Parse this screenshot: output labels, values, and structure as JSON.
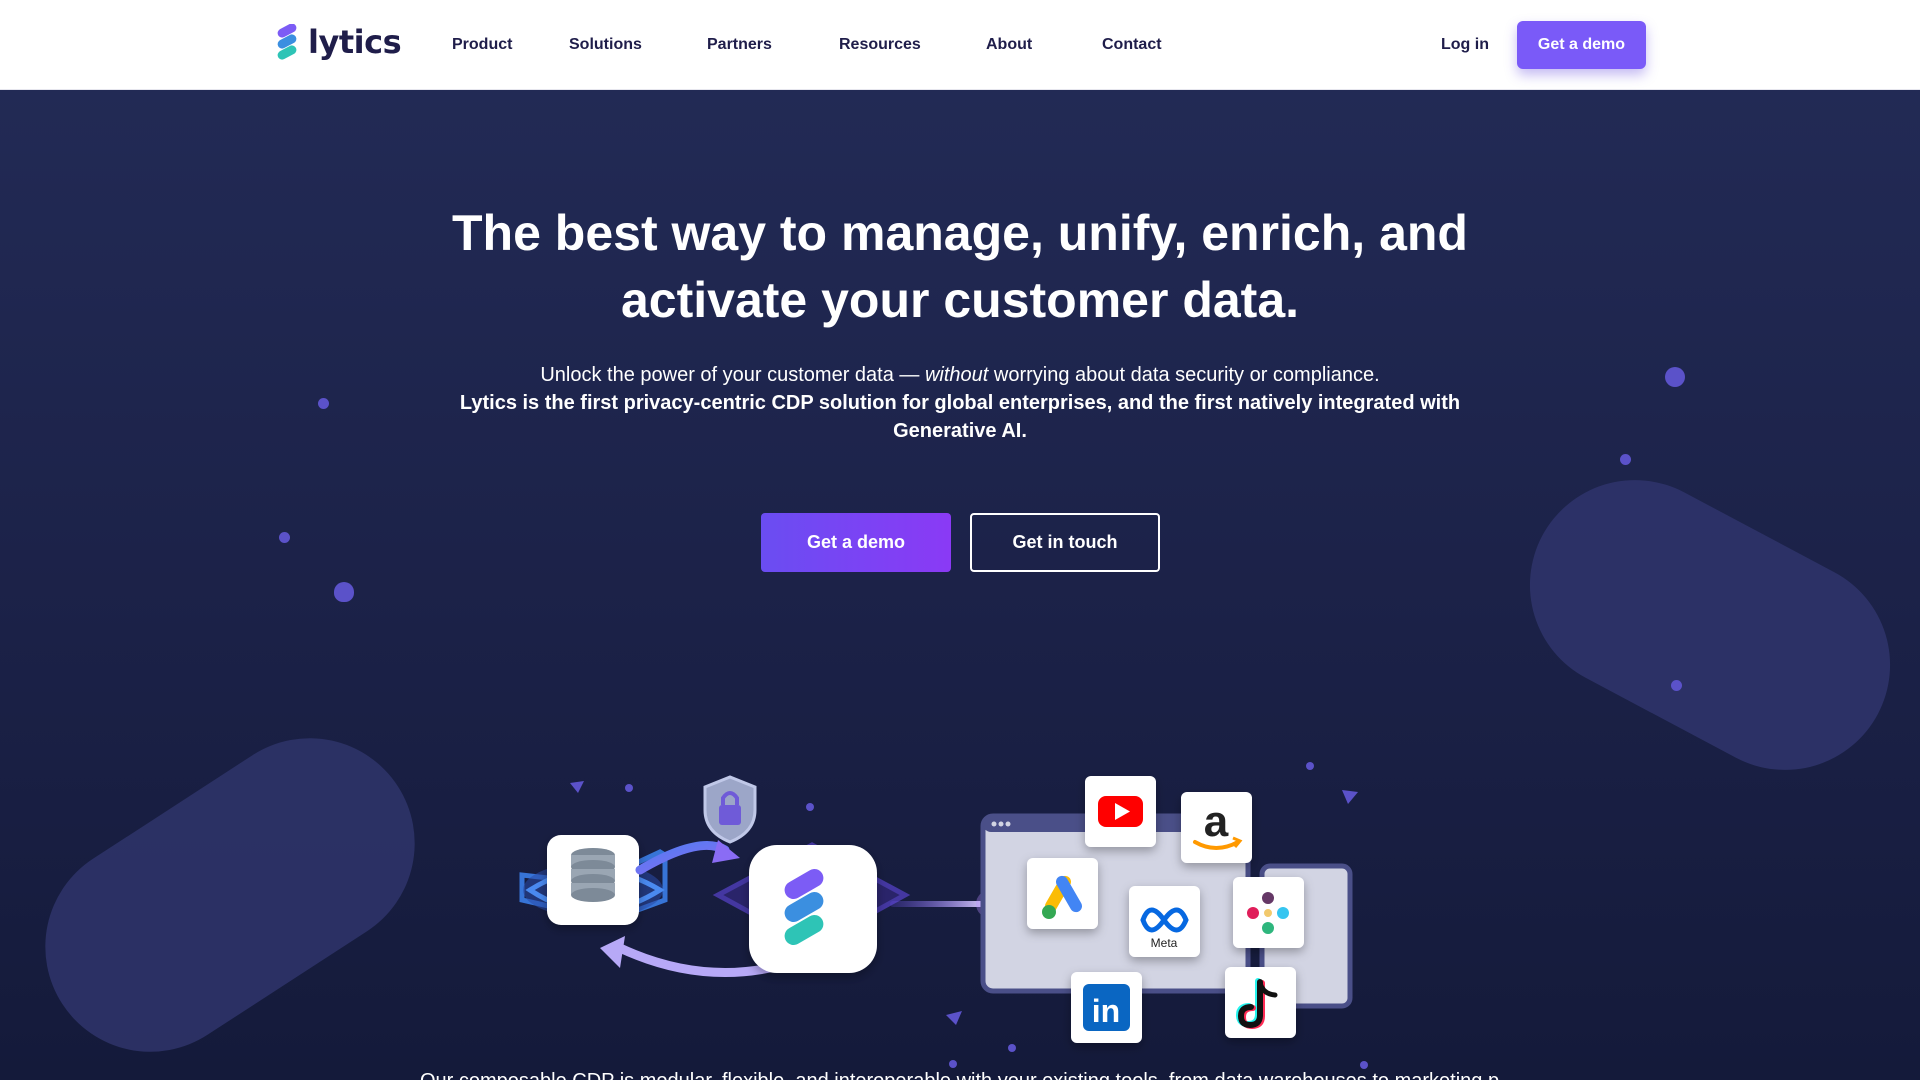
{
  "brand": {
    "name": "lytics",
    "colors": {
      "primary": "#7a5af8",
      "navy": "#1f1d4a",
      "hero_bg": "#1e2550",
      "teal": "#2ec4b6",
      "blue": "#3b8fe0",
      "purple": "#7c5cf5"
    }
  },
  "nav": {
    "items": [
      "Product",
      "Solutions",
      "Partners",
      "Resources",
      "About",
      "Contact"
    ],
    "login_label": "Log in",
    "demo_label": "Get a demo"
  },
  "hero": {
    "headline": "The best way to manage, unify, enrich, and activate your customer data.",
    "sub_prefix": "Unlock the power of your customer data — ",
    "sub_em": "without",
    "sub_suffix": " worrying about data security or compliance.",
    "sub_bold": "Lytics is the first privacy-centric CDP solution for global enterprises, and the first natively integrated with Generative AI.",
    "cta_primary": "Get a demo",
    "cta_secondary": "Get in touch"
  },
  "illustration": {
    "left_icons": [
      "database-icon",
      "lock-shield-icon",
      "lytics-logo-icon"
    ],
    "partner_icons": [
      "youtube-icon",
      "amazon-icon",
      "google-ads-icon",
      "meta-icon",
      "slack-icon",
      "linkedin-icon",
      "tiktok-icon"
    ],
    "meta_label": "Meta",
    "amazon_letter": "a",
    "linkedin_label": "in"
  },
  "footer_teaser": "Our composable CDP is modular, flexible, and interoperable with your existing tools, from data warehouses to marketing platforms."
}
